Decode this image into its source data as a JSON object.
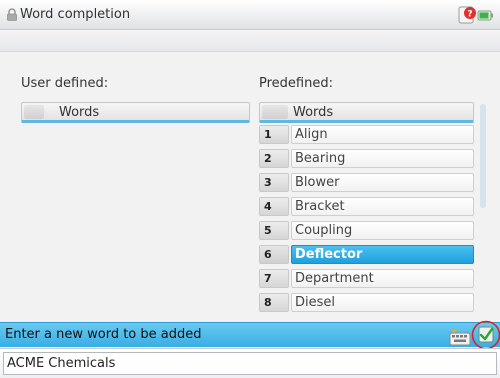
{
  "window": {
    "title": "Word completion",
    "icons": [
      "padlock-icon",
      "help-icon",
      "battery-icon"
    ]
  },
  "user_defined": {
    "label": "User defined:",
    "column_header": "Words",
    "words": []
  },
  "predefined": {
    "label": "Predefined:",
    "column_header": "Words",
    "items": [
      {
        "num": "1",
        "word": "Align"
      },
      {
        "num": "2",
        "word": "Bearing"
      },
      {
        "num": "3",
        "word": "Blower"
      },
      {
        "num": "4",
        "word": "Bracket"
      },
      {
        "num": "5",
        "word": "Coupling"
      },
      {
        "num": "6",
        "word": "Deflector",
        "selected": true
      },
      {
        "num": "7",
        "word": "Department"
      },
      {
        "num": "8",
        "word": "Diesel"
      }
    ]
  },
  "prompt": {
    "text": "Enter a new word to be added",
    "icons": [
      "keyboard-icon",
      "accept-icon"
    ]
  },
  "input": {
    "value": "ACME Chemicals"
  },
  "colors": {
    "accent": "#38aee4",
    "selection": "#1e9fdc",
    "highlight_ring": "#d9232a"
  }
}
